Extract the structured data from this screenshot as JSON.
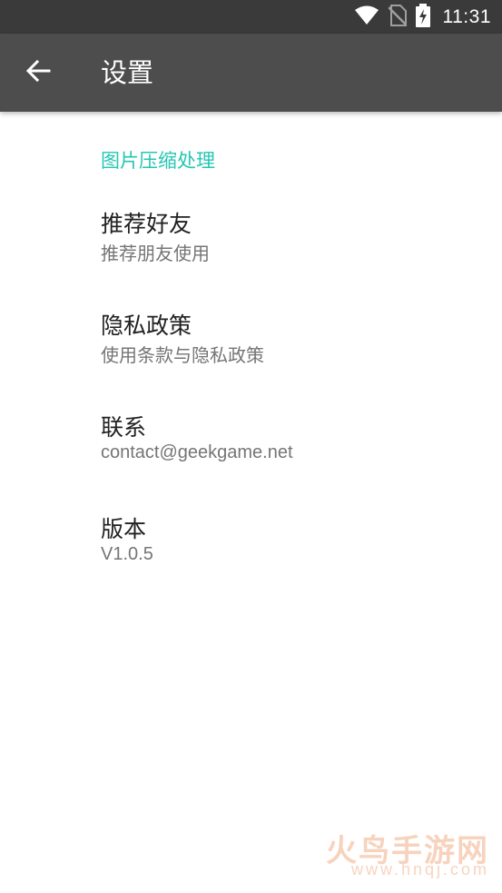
{
  "status_bar": {
    "time": "11:31",
    "icons": [
      "wifi-icon",
      "no-sim-icon",
      "battery-charging-icon"
    ]
  },
  "app_bar": {
    "back_icon": "arrow-back-icon",
    "title": "设置"
  },
  "category": {
    "title": "图片压缩处理"
  },
  "preferences": [
    {
      "title": "推荐好友",
      "summary": "推荐朋友使用"
    },
    {
      "title": "隐私政策",
      "summary": "使用条款与隐私政策"
    },
    {
      "title": "联系",
      "summary": "contact@geekgame.net"
    },
    {
      "title": "版本",
      "summary": "V1.0.5"
    }
  ],
  "watermark": {
    "brand": "火鸟手游网",
    "url": "www.hnqj.com"
  },
  "colors": {
    "status_bar": "#3a3a3a",
    "app_bar": "#4d4d4d",
    "accent": "#26c6b2",
    "title_text": "#212121",
    "summary_text": "#757575"
  }
}
